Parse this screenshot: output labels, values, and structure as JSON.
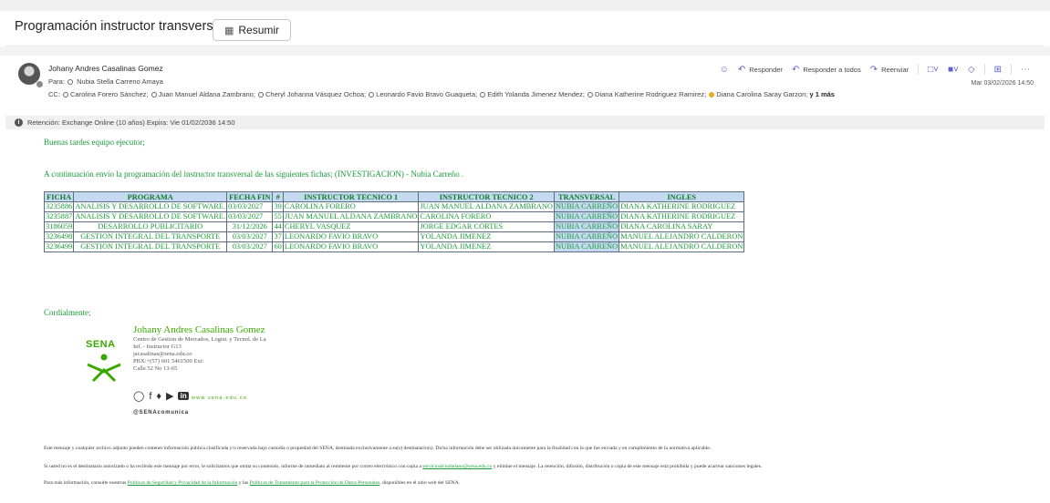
{
  "message": {
    "subject": "Programación instructor transversal",
    "summarize_label": "Resumir",
    "sender": "Johany Andres Casalinas Gomez",
    "to_label": "Para:",
    "to": "Nubia Stella Carreno Amaya",
    "cc_label": "CC:",
    "cc": [
      "Carolina Forero Sánchez;",
      "Juan Manuel Aldana Zambrano;",
      "Cheryl Johanna Vásquez Ochoa;",
      "Leonardo Favio Bravo Guaqueta;",
      "Edith Yolanda Jimenez Mendez;",
      "Diana Katherine Rodriguez Ramirez;",
      "Diana Carolina Saray Garzon;"
    ],
    "cc_more": "y 1 más",
    "date": "Mar 03/02/2026 14:50",
    "actions": {
      "reply": "Responder",
      "reply_all": "Responder a todos",
      "forward": "Reenviar"
    },
    "retention": "Retención: Exchange Online (10 años) Expira: Vie 01/02/2036 14:50"
  },
  "body": {
    "greeting": "Buenas tardes equipo ejecutor;",
    "intro": "A continuación envío la programación del instructor transversal de las siguientes fichas; (INVESTIGACION) - Nubia Carreño .",
    "table": {
      "headers": [
        "FICHA",
        "PROGRAMA",
        "FECHA FIN",
        "#",
        "INSTRUCTOR TECNICO 1",
        "INSTRUCTOR TECNICO 2",
        "TRANSVERSAL",
        "INGLES"
      ],
      "rows": [
        [
          "3235886",
          "ANALISIS Y DESARROLLO DE SOFTWARE.",
          "03/03/2027",
          "39",
          "CAROLINA FORERO",
          "JUAN MANUEL ALDANA ZAMBRANO",
          "NUBIA CARREÑO",
          "DIANA KATHERINE RODRIGUEZ"
        ],
        [
          "3235887",
          "ANALISIS Y DESARROLLO DE SOFTWARE.",
          "03/03/2027",
          "55",
          "JUAN MANUEL ALDANA ZAMBRANO",
          "CAROLINA FORERO",
          "NUBIA CARREÑO",
          "DIANA KATHERINE RODRIGUEZ"
        ],
        [
          "3186059",
          "DESARROLLO PUBLICITARIO",
          "31/12/2026",
          "44",
          "CHERYL VASQUEZ",
          "JORGE EDGAR CORTES",
          "NUBIA CARREÑO",
          "DIANA CAROLINA SARAY"
        ],
        [
          "3236498",
          "GESTION INTEGRAL DEL TRANSPORTE",
          "03/03/2027",
          "37",
          "LEONARDO FAVIO BRAVO",
          "YOLANDA JIMENEZ",
          "NUBIA CARREÑO",
          "MANUEL ALEJANDRO CALDERON"
        ],
        [
          "3236499",
          "GESTION INTEGRAL DEL TRANSPORTE",
          "03/03/2027",
          "60",
          "LEONARDO FAVIO BRAVO",
          "YOLANDA JIMENEZ",
          "NUBIA CARREÑO",
          "MANUEL ALEJANDRO CALDERON"
        ]
      ]
    },
    "closing": "Cordialmente;",
    "signature": {
      "logo_text": "SENA",
      "name": "Johany Andres Casalinas Gomez",
      "lines": [
        "Centro de Gestion de Mercados, Logist. y Tecnol. de La",
        "Inf. - Instructor G13",
        "jacasalinas@sena.edu.co",
        "PBX:+(57) 601 5461500 Ext:",
        "Calle 52 No 13-65"
      ],
      "web": "www.sena.edu.co",
      "handle": "@SENAcomunica"
    },
    "disclaimer": {
      "p1": "Este mensaje y cualquier archivo adjunto pueden contener información pública clasificada y/o reservada bajo custodia o propiedad del SENA, destinada exclusivamente a su(s) destinatario(s). Dicha información debe ser utilizada únicamente para la finalidad con la que fue enviada y en cumplimiento de la normativa aplicable.",
      "p2a": "Si usted no es el destinatario autorizado o ha recibido este mensaje por error, le solicitamos que omita su contenido, informe de inmediato al remitente por correo electrónico con copia a",
      "p2_link": "servicioalciudadano@sena.edu.co",
      "p2b": "y elimine el mensaje. La retención, difusión, distribución o copia de este mensaje está prohibida y puede acarrear sanciones legales.",
      "p3a": "Para más información, consulte nuestras",
      "p3_link1": "Políticas de Seguridad y Privacidad de la Información",
      "p3b": "y las",
      "p3_link2": "Políticas de Tratamiento para la Protección de Datos Personales",
      "p3c": ", disponibles en el sitio web del SENA."
    }
  }
}
